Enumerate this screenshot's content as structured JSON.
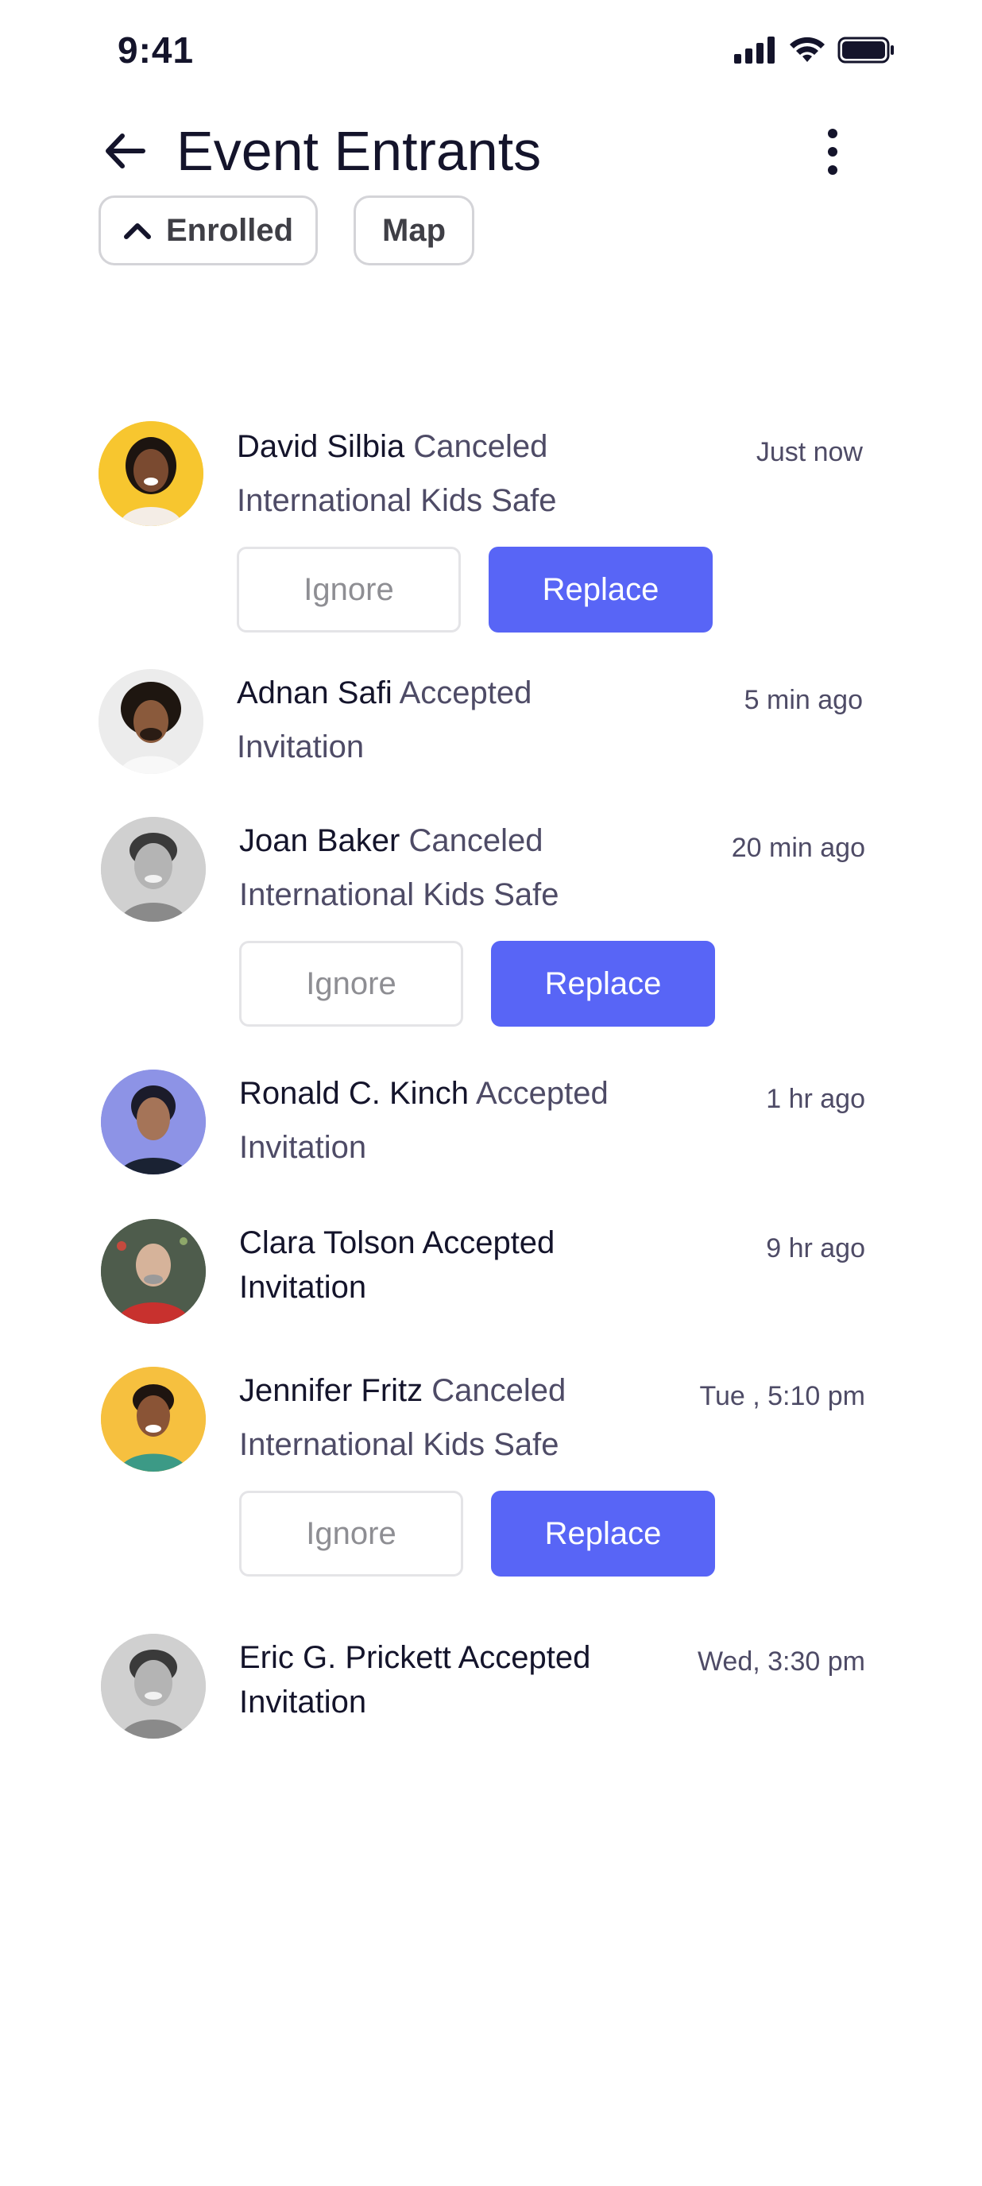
{
  "status_bar": {
    "time": "9:41"
  },
  "header": {
    "title": "Event Entrants"
  },
  "filters": {
    "enrolled_label": "Enrolled",
    "map_label": "Map"
  },
  "colors": {
    "accent": "#5865f6",
    "text_dark": "#14142b",
    "text_muted": "#4e4b66"
  },
  "items": [
    {
      "name": "David Silbia",
      "status": "Canceled",
      "detail": "International Kids Safe",
      "time": "Just now",
      "ignore_label": "Ignore",
      "replace_label": "Replace"
    },
    {
      "name": "Adnan Safi",
      "status": "Accepted",
      "detail": "Invitation",
      "time": "5 min ago"
    },
    {
      "name": "Joan Baker",
      "status": "Canceled",
      "detail": "International Kids Safe",
      "time": "20 min ago",
      "ignore_label": "Ignore",
      "replace_label": "Replace"
    },
    {
      "name": "Ronald C. Kinch",
      "status": "Accepted",
      "detail": "Invitation",
      "time": "1 hr ago"
    },
    {
      "name": "Clara Tolson",
      "status": "Accepted",
      "detail": "Invitation",
      "time": "9 hr ago"
    },
    {
      "name": "Jennifer Fritz",
      "status": "Canceled",
      "detail": "International Kids Safe",
      "time": "Tue , 5:10 pm",
      "ignore_label": "Ignore",
      "replace_label": "Replace"
    },
    {
      "name": "Eric G. Prickett",
      "status": "Accepted",
      "detail": "Invitation",
      "time": "Wed, 3:30 pm"
    }
  ]
}
